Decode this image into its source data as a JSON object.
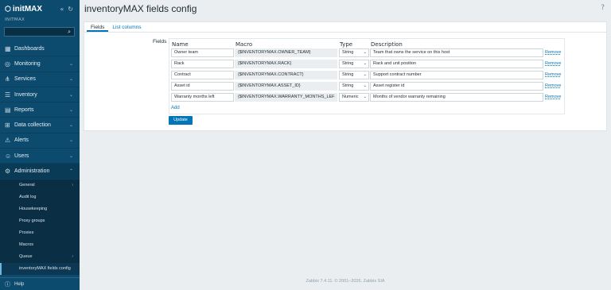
{
  "brand": {
    "logo_text": "initMAX",
    "server_name": "INITMAX"
  },
  "sidebar": {
    "search_placeholder": "",
    "items": [
      {
        "label": "Dashboards",
        "icon": "dashboard-icon"
      },
      {
        "label": "Monitoring",
        "icon": "monitoring-icon",
        "chevron": "⌄"
      },
      {
        "label": "Services",
        "icon": "services-icon",
        "chevron": "⌄"
      },
      {
        "label": "Inventory",
        "icon": "inventory-icon",
        "chevron": "⌄"
      },
      {
        "label": "Reports",
        "icon": "reports-icon",
        "chevron": "⌄"
      },
      {
        "label": "Data collection",
        "icon": "data-collection-icon",
        "chevron": "⌄"
      },
      {
        "label": "Alerts",
        "icon": "alerts-icon",
        "chevron": "⌄"
      },
      {
        "label": "Users",
        "icon": "users-icon",
        "chevron": "⌄"
      },
      {
        "label": "Administration",
        "icon": "administration-icon",
        "chevron": "⌃"
      }
    ],
    "admin_submenu": [
      {
        "label": "General",
        "chevron": "›"
      },
      {
        "label": "Audit log"
      },
      {
        "label": "Housekeeping"
      },
      {
        "label": "Proxy groups"
      },
      {
        "label": "Proxies"
      },
      {
        "label": "Macros"
      },
      {
        "label": "Queue",
        "chevron": "›"
      },
      {
        "label": "inventoryMAX fields config"
      }
    ],
    "help_label": "Help"
  },
  "header": {
    "title": "inventoryMAX fields config",
    "help": "?"
  },
  "tabs": [
    {
      "label": "Fields",
      "active": true
    },
    {
      "label": "List columns",
      "active": false
    }
  ],
  "form": {
    "fields_label": "Fields",
    "columns": {
      "name": "Name",
      "macro": "Macro",
      "type": "Type",
      "description": "Description"
    },
    "rows": [
      {
        "name": "Owner team",
        "macro": "{$INVENTORYMAX.OWNER_TEAM}",
        "type": "String",
        "description": "Team that owns the service on this host",
        "remove": "Remove"
      },
      {
        "name": "Rack",
        "macro": "{$INVENTORYMAX.RACK}",
        "type": "String",
        "description": "Rack and unit position",
        "remove": "Remove"
      },
      {
        "name": "Contract",
        "macro": "{$INVENTORYMAX.CONTRACT}",
        "type": "String",
        "description": "Support contract number",
        "remove": "Remove"
      },
      {
        "name": "Asset id",
        "macro": "{$INVENTORYMAX.ASSET_ID}",
        "type": "String",
        "description": "Asset register id",
        "remove": "Remove"
      },
      {
        "name": "Warranty months left",
        "macro": "{$INVENTORYMAX.WARRANTY_MONTHS_LEF",
        "type": "Numeric",
        "description": "Months of vendor warranty remaining",
        "remove": "Remove"
      }
    ],
    "add_label": "Add",
    "update_label": "Update"
  },
  "footer": {
    "text": "Zabbix 7.4.11. © 2001–2026, Zabbix SIA"
  }
}
